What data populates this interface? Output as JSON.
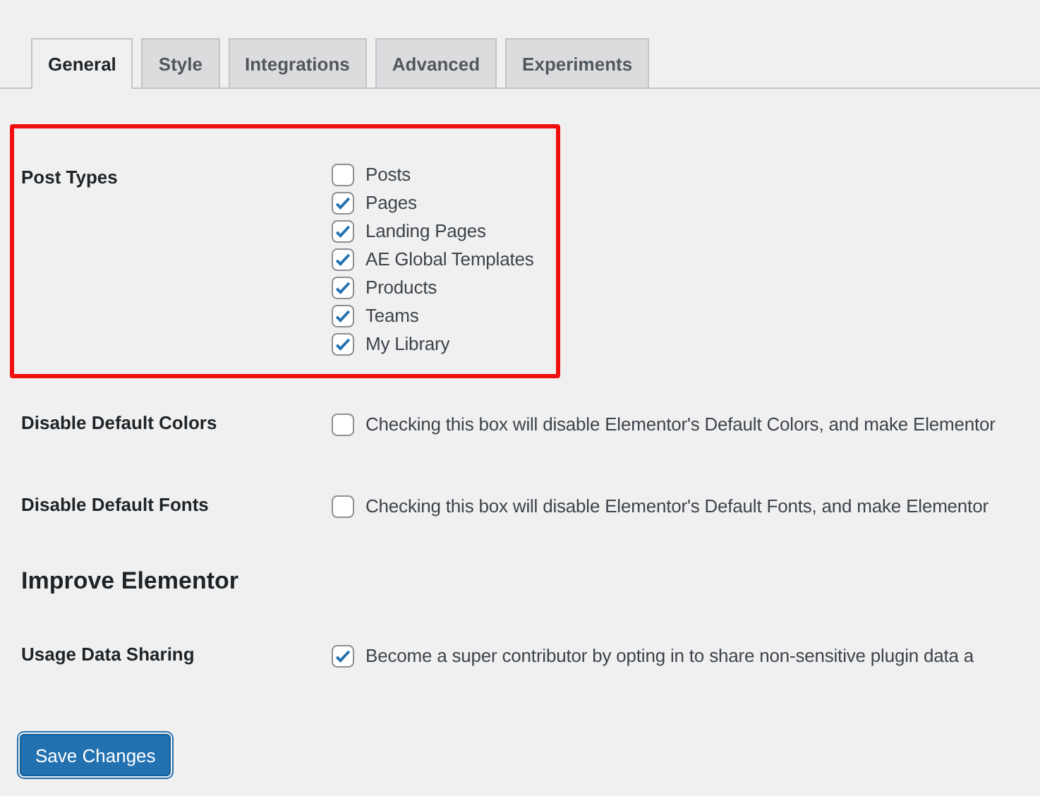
{
  "tabs": [
    {
      "label": "General",
      "selected": true
    },
    {
      "label": "Style",
      "selected": false
    },
    {
      "label": "Integrations",
      "selected": false
    },
    {
      "label": "Advanced",
      "selected": false
    },
    {
      "label": "Experiments",
      "selected": false
    }
  ],
  "post_types": {
    "label": "Post Types",
    "options": [
      {
        "label": "Posts",
        "checked": false
      },
      {
        "label": "Pages",
        "checked": true
      },
      {
        "label": "Landing Pages",
        "checked": true
      },
      {
        "label": "AE Global Templates",
        "checked": true
      },
      {
        "label": "Products",
        "checked": true
      },
      {
        "label": "Teams",
        "checked": true
      },
      {
        "label": "My Library",
        "checked": true
      }
    ]
  },
  "settings": [
    {
      "label": "Disable Default Colors",
      "checked": false,
      "description": "Checking this box will disable Elementor's Default Colors, and make Elementor"
    },
    {
      "label": "Disable Default Fonts",
      "checked": false,
      "description": "Checking this box will disable Elementor's Default Fonts, and make Elementor"
    }
  ],
  "section_heading": "Improve Elementor",
  "improve_settings": [
    {
      "label": "Usage Data Sharing",
      "checked": true,
      "description": "Become a super contributor by opting in to share non-sensitive plugin data a"
    }
  ],
  "save_button": "Save Changes"
}
